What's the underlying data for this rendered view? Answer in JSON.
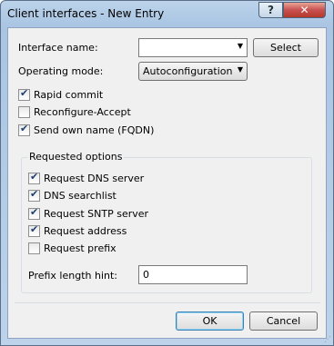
{
  "window": {
    "title": "Client interfaces - New Entry",
    "help_label": "?",
    "close_label": "✕"
  },
  "form": {
    "interface_name_label": "Interface name:",
    "interface_name_value": "",
    "select_button": "Select",
    "operating_mode_label": "Operating mode:",
    "operating_mode_value": "Autoconfiguration"
  },
  "options": [
    {
      "label": "Rapid commit",
      "checked": true
    },
    {
      "label": "Reconfigure-Accept",
      "checked": false
    },
    {
      "label": "Send own name (FQDN)",
      "checked": true
    }
  ],
  "requested": {
    "title": "Requested options",
    "items": [
      {
        "label": "Request DNS server",
        "checked": true
      },
      {
        "label": "DNS searchlist",
        "checked": true
      },
      {
        "label": "Request SNTP server",
        "checked": true
      },
      {
        "label": "Request address",
        "checked": true
      },
      {
        "label": "Request prefix",
        "checked": false
      }
    ],
    "prefix_hint_label": "Prefix length hint:",
    "prefix_hint_value": "0"
  },
  "buttons": {
    "ok": "OK",
    "cancel": "Cancel"
  }
}
